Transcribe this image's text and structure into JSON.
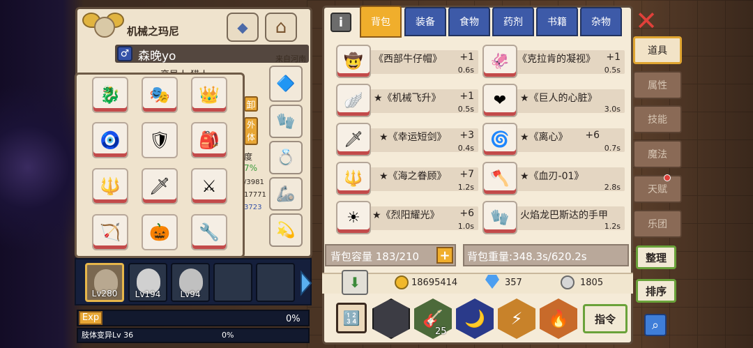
{
  "character": {
    "title": "机械之玛尼",
    "name": "森晚yo",
    "origin": "来自河南",
    "subline": "变异人 猎人",
    "side_button_1": "卸",
    "side_button_2": "外体",
    "side_text_1": "度",
    "side_text_2": "7%",
    "side_text_3": "/3981",
    "side_text_4": "17771",
    "side_text_5": "3723"
  },
  "equipment": {
    "slots": [
      {
        "icon": "🐉",
        "name": "dragon-helm"
      },
      {
        "icon": "🎭",
        "name": "dark-mask"
      },
      {
        "icon": "👑",
        "name": "golden-crest"
      },
      {
        "icon": "🧿",
        "name": "red-orb"
      },
      {
        "icon": "🛡",
        "name": "keyhole-shield"
      },
      {
        "icon": "🎒",
        "name": "red-backpack"
      },
      {
        "icon": "🔱",
        "name": "trident"
      },
      {
        "icon": "🗡",
        "name": "gold-spear"
      },
      {
        "icon": "⚔",
        "name": "orange-spear"
      },
      {
        "icon": "🏹",
        "name": "green-crossbow"
      },
      {
        "icon": "🎃",
        "name": "pumpkin-wand"
      },
      {
        "icon": "🔧",
        "name": "wrench"
      }
    ],
    "side_slots": [
      {
        "icon": "🔷"
      },
      {
        "icon": "🧤"
      },
      {
        "icon": "💍"
      },
      {
        "icon": "🦾"
      },
      {
        "icon": "💫"
      }
    ]
  },
  "party": {
    "members": [
      {
        "level": "Lv280",
        "selected": true
      },
      {
        "level": "Lv194",
        "selected": false
      },
      {
        "level": "Lv94",
        "selected": false
      },
      {
        "level": "",
        "selected": false
      },
      {
        "level": "",
        "selected": false
      }
    ]
  },
  "exp": {
    "label": "Exp",
    "percent": "0%",
    "sub_label": "肢体变异Lv 36",
    "sub_percent": "0%"
  },
  "inventory": {
    "info_icon": "i",
    "tabs": [
      {
        "label": "背包",
        "active": true
      },
      {
        "label": "装备",
        "active": false
      },
      {
        "label": "食物",
        "active": false
      },
      {
        "label": "药剂",
        "active": false
      },
      {
        "label": "书籍",
        "active": false
      },
      {
        "label": "杂物",
        "active": false
      }
    ],
    "items": [
      {
        "name": "《西部牛仔帽》",
        "count": "+1",
        "weight": "0.6s",
        "icon": "🤠"
      },
      {
        "name": "《克拉肯的凝视》",
        "count": "+1",
        "weight": "0.5s",
        "icon": "🦑"
      },
      {
        "name": "★《机械飞升》",
        "count": "+1",
        "weight": "0.5s",
        "icon": "🪽"
      },
      {
        "name": "★《巨人的心脏》",
        "count": "",
        "weight": "3.0s",
        "icon": "❤"
      },
      {
        "name": "★《幸运短剑》",
        "count": "+3",
        "weight": "0.4s",
        "icon": "🗡"
      },
      {
        "name": "★《离心》",
        "count": "+6",
        "weight": "0.7s",
        "icon": "🌀"
      },
      {
        "name": "★《海之眷顾》",
        "count": "+7",
        "weight": "1.2s",
        "icon": "🔱"
      },
      {
        "name": "★《血刃-01》",
        "count": "",
        "weight": "2.8s",
        "icon": "🪓"
      },
      {
        "name": "★《烈阳耀光》",
        "count": "+6",
        "weight": "1.0s",
        "icon": "☀"
      },
      {
        "name": "火焰龙巴斯达的手甲",
        "count": "",
        "weight": "1.2s",
        "icon": "🧤"
      }
    ],
    "capacity_label": "背包容量 183/210",
    "plus_label": "+",
    "weight_label": "背包重量:348.3s/620.2s",
    "currency": {
      "gold": "18695414",
      "diamond": "357",
      "silver": "1805"
    },
    "tools": [
      {
        "icon": "🔢",
        "badge": ""
      },
      {
        "icon": "",
        "badge": ""
      },
      {
        "icon": "🎸",
        "badge": "25"
      },
      {
        "icon": "🌙",
        "badge": ""
      },
      {
        "icon": "⚡",
        "badge": ""
      },
      {
        "icon": "🔥",
        "badge": ""
      }
    ],
    "command_label": "指令"
  },
  "side_tabs": [
    {
      "label": "道具",
      "active": true
    },
    {
      "label": "属性",
      "active": false
    },
    {
      "label": "技能",
      "active": false
    },
    {
      "label": "魔法",
      "active": false
    },
    {
      "label": "天赋",
      "active": false
    },
    {
      "label": "乐团",
      "active": false
    }
  ],
  "actions": {
    "organize": "整理",
    "sort": "排序"
  },
  "colors": {
    "active_tab": "#f0ae2c",
    "inactive_tab": "#3d5aa8",
    "green_border": "#6aa23a",
    "close_red": "#e0403a"
  }
}
